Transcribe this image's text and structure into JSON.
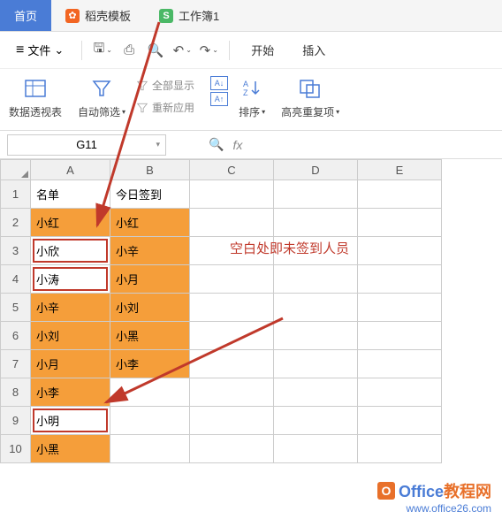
{
  "tabs": {
    "home": "首页",
    "docer": "稻壳模板",
    "workbook": "工作簿1"
  },
  "toolbar": {
    "file": "文件",
    "start": "开始",
    "insert": "插入"
  },
  "ribbon": {
    "pivot": "数据透视表",
    "autofilter": "自动筛选",
    "showall": "全部显示",
    "reapply": "重新应用",
    "sort": "排序",
    "highlight_dup": "高亮重复项"
  },
  "cellref": "G11",
  "cols": [
    "A",
    "B",
    "C",
    "D",
    "E"
  ],
  "rows": [
    "1",
    "2",
    "3",
    "4",
    "5",
    "6",
    "7",
    "8",
    "9",
    "10"
  ],
  "data": {
    "header_a": "名单",
    "header_b": "今日签到",
    "a": [
      "小红",
      "小欣",
      "小涛",
      "小辛",
      "小刘",
      "小月",
      "小李",
      "小明",
      "小黑"
    ],
    "b": [
      "小红",
      "小辛",
      "小月",
      "小刘",
      "小黑",
      "小李",
      "",
      "",
      ""
    ]
  },
  "annotation": "空白处即未签到人员",
  "watermark": {
    "brand": "Office",
    "suffix": "教程网",
    "url": "www.office26.com"
  }
}
